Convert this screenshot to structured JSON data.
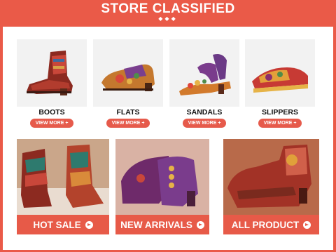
{
  "header": {
    "title": "STORE CLASSIFIED",
    "ornament": "◆◆◆"
  },
  "categories": [
    {
      "name": "BOOTS",
      "button": "VIEW MORE +"
    },
    {
      "name": "FLATS",
      "button": "VIEW MORE +"
    },
    {
      "name": "SANDALS",
      "button": "VIEW MORE +"
    },
    {
      "name": "SLIPPERS",
      "button": "VIEW MORE +"
    }
  ],
  "promos": [
    {
      "label": "HOT SALE"
    },
    {
      "label": "NEW ARRIVALS"
    },
    {
      "label": "ALL PRODUCT"
    }
  ],
  "colors": {
    "brand": "#ea5a48",
    "button": "#e65a4b",
    "panel": "#ffffff"
  }
}
